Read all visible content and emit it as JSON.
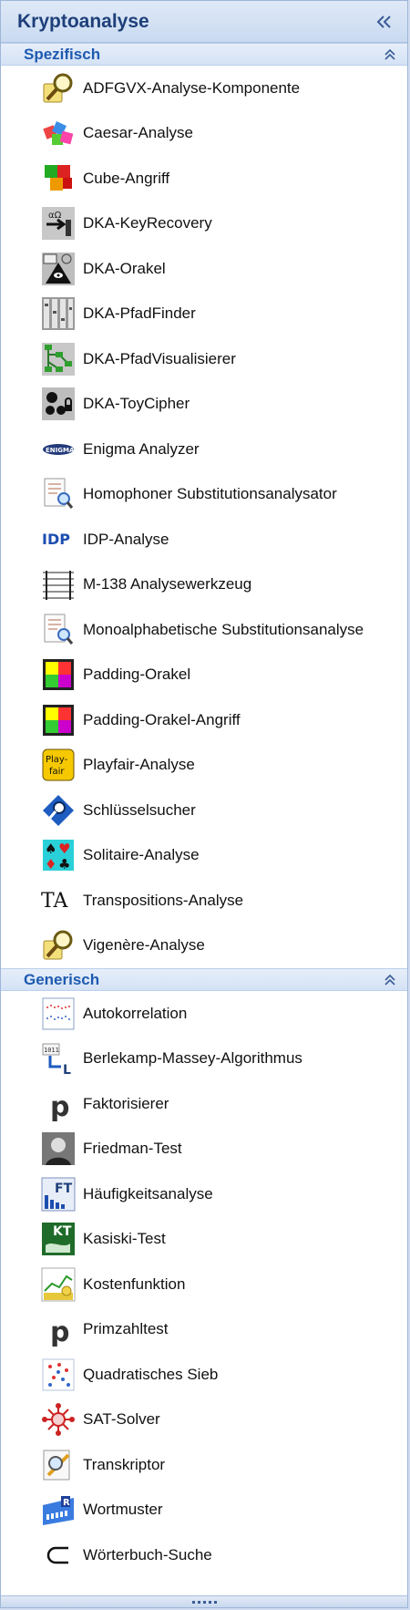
{
  "panel": {
    "title": "Kryptoanalyse"
  },
  "groups": [
    {
      "title": "Spezifisch",
      "items": [
        {
          "label": "ADFGVX-Analyse-Komponente",
          "icon": "magnifier-paper-icon"
        },
        {
          "label": "Caesar-Analyse",
          "icon": "colored-blocks-icon"
        },
        {
          "label": "Cube-Angriff",
          "icon": "cubes-icon"
        },
        {
          "label": "DKA-KeyRecovery",
          "icon": "key-recovery-icon"
        },
        {
          "label": "DKA-Orakel",
          "icon": "pyramid-eye-icon"
        },
        {
          "label": "DKA-PfadFinder",
          "icon": "grid-path-icon"
        },
        {
          "label": "DKA-PfadVisualisierer",
          "icon": "path-graph-icon"
        },
        {
          "label": "DKA-ToyCipher",
          "icon": "toy-lock-icon"
        },
        {
          "label": "Enigma Analyzer",
          "icon": "enigma-logo-icon"
        },
        {
          "label": "Homophoner Substitutionsanalysator",
          "icon": "document-magnifier-icon"
        },
        {
          "label": "IDP-Analyse",
          "icon": "idp-text-icon"
        },
        {
          "label": "M-138 Analysewerkzeug",
          "icon": "strip-cipher-icon"
        },
        {
          "label": "Monoalphabetische Substitutionsanalyse",
          "icon": "document-magnifier-icon"
        },
        {
          "label": "Padding-Orakel",
          "icon": "color-square-icon"
        },
        {
          "label": "Padding-Orakel-Angriff",
          "icon": "color-square-icon"
        },
        {
          "label": "Playfair-Analyse",
          "icon": "playfair-icon"
        },
        {
          "label": "Schlüsselsucher",
          "icon": "key-search-diamond-icon"
        },
        {
          "label": "Solitaire-Analyse",
          "icon": "playing-cards-icon"
        },
        {
          "label": "Transpositions-Analyse",
          "icon": "ta-text-icon"
        },
        {
          "label": "Vigenère-Analyse",
          "icon": "magnifier-paper-icon"
        }
      ]
    },
    {
      "title": "Generisch",
      "items": [
        {
          "label": "Autokorrelation",
          "icon": "chart-dots-icon"
        },
        {
          "label": "Berlekamp-Massey-Algorithmus",
          "icon": "binary-arrow-icon"
        },
        {
          "label": "Faktorisierer",
          "icon": "p-letter-icon"
        },
        {
          "label": "Friedman-Test",
          "icon": "portrait-icon"
        },
        {
          "label": "Häufigkeitsanalyse",
          "icon": "ft-bar-chart-icon"
        },
        {
          "label": "Kasiski-Test",
          "icon": "kt-hand-icon"
        },
        {
          "label": "Kostenfunktion",
          "icon": "cost-chart-icon"
        },
        {
          "label": "Primzahltest",
          "icon": "p-letter-icon"
        },
        {
          "label": "Quadratisches Sieb",
          "icon": "sieve-dots-icon"
        },
        {
          "label": "SAT-Solver",
          "icon": "sat-molecule-icon"
        },
        {
          "label": "Transkriptor",
          "icon": "pencil-magnifier-icon"
        },
        {
          "label": "Wortmuster",
          "icon": "word-pattern-icon"
        },
        {
          "label": "Wörterbuch-Suche",
          "icon": "subset-symbol-icon"
        }
      ]
    }
  ]
}
